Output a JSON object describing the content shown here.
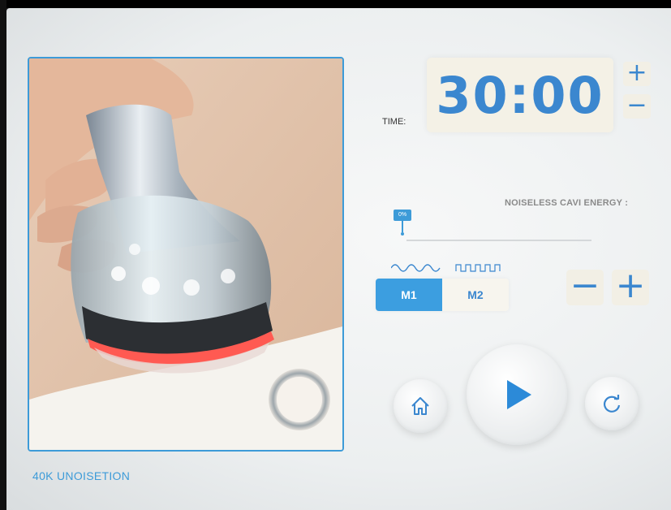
{
  "timer": {
    "label": "TIME:",
    "value": "30:00",
    "increase_label": "+",
    "decrease_label": "−"
  },
  "energy": {
    "label": "NOISELESS CAVI ENERGY :",
    "level_text": "0%",
    "level": 0,
    "decrease_label": "−",
    "increase_label": "+"
  },
  "modes": {
    "options": [
      "M1",
      "M2"
    ],
    "selected": "M1",
    "icons": [
      "sine-wave-icon",
      "square-wave-icon"
    ]
  },
  "controls": {
    "home_icon": "home-icon",
    "play_icon": "play-icon",
    "reset_icon": "refresh-icon"
  },
  "footer": {
    "mode_name": "40K UNOISETION"
  },
  "colors": {
    "accent": "#3b87cf",
    "active_fill": "#3c9ee0",
    "frame": "#3d9bd8"
  }
}
